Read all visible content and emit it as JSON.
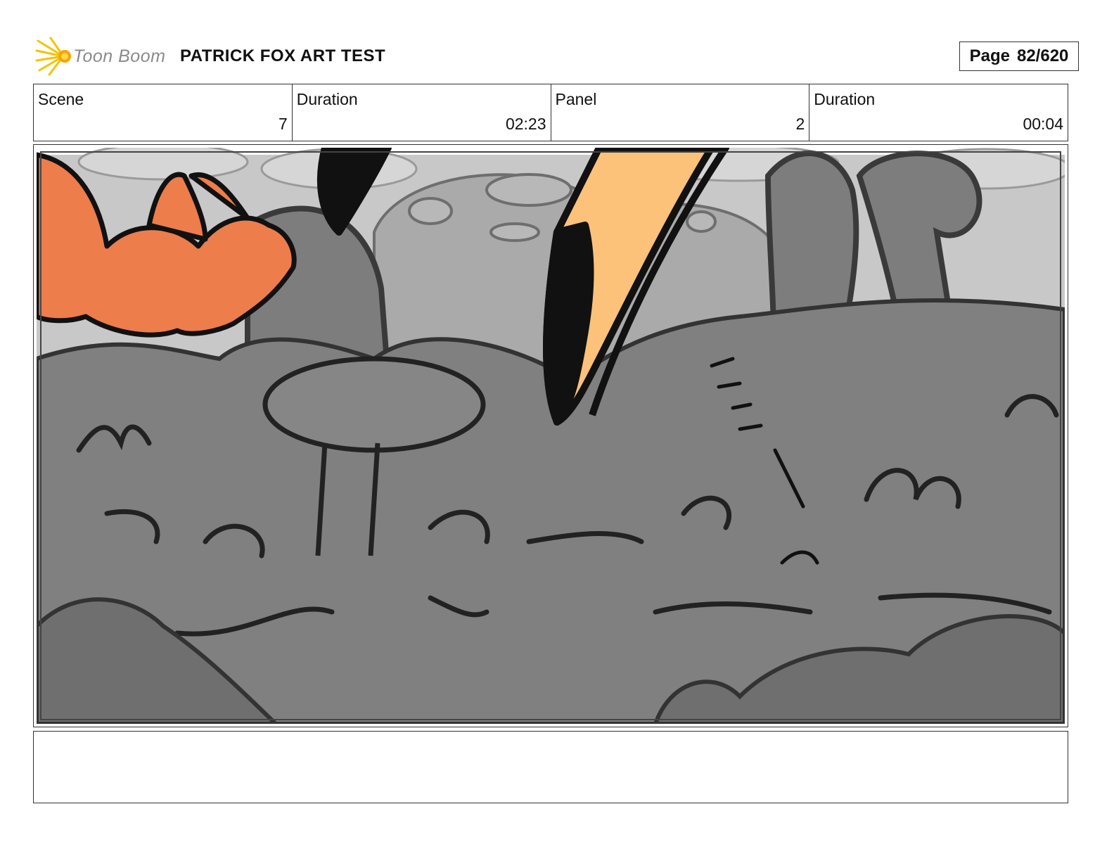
{
  "header": {
    "logo_text": "Toon Boom",
    "title": "PATRICK FOX ART TEST",
    "page_label": "Page",
    "page_value": "82/620"
  },
  "info": {
    "scene_label": "Scene",
    "scene_value": "7",
    "scene_duration_label": "Duration",
    "scene_duration_value": "02:23",
    "panel_label": "Panel",
    "panel_value": "2",
    "panel_duration_label": "Duration",
    "panel_duration_value": "00:04"
  },
  "notes": {
    "text": ""
  },
  "colors": {
    "fox_orange": "#ed7d4b",
    "beak_orange": "#fcc27a",
    "ink": "#111111",
    "bg_gray": "#8a8a8a"
  }
}
